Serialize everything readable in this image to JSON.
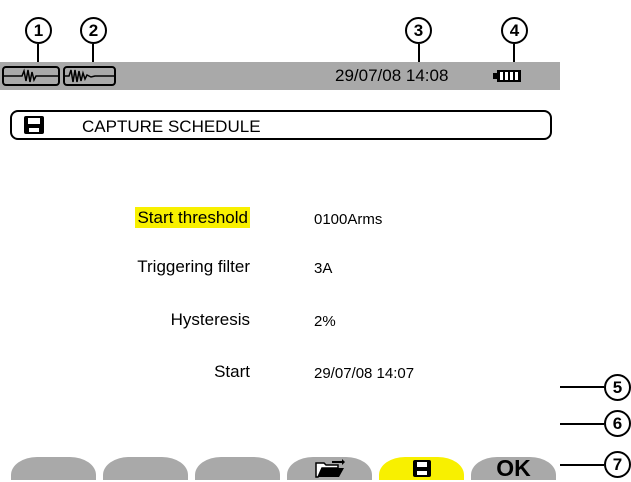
{
  "callouts": [
    "1",
    "2",
    "3",
    "4",
    "5",
    "6",
    "7"
  ],
  "status_bar": {
    "datetime": "29/07/08 14:08",
    "icons": [
      "waveform-1-icon",
      "waveform-2-icon",
      "battery-full-icon"
    ]
  },
  "header": {
    "icon": "floppy-disk-icon",
    "title": "CAPTURE SCHEDULE"
  },
  "fields": [
    {
      "label": "Start threshold",
      "value": "0100Arms",
      "selected": true
    },
    {
      "label": "Triggering filter",
      "value": "3A",
      "selected": false
    },
    {
      "label": "Hysteresis",
      "value": "2%",
      "selected": false
    },
    {
      "label": "Start",
      "value": "29/07/08 14:07",
      "selected": false
    }
  ],
  "softkeys": [
    {
      "label": "",
      "icon": ""
    },
    {
      "label": "",
      "icon": ""
    },
    {
      "label": "",
      "icon": ""
    },
    {
      "label": "",
      "icon": "folder-open-icon"
    },
    {
      "label": "",
      "icon": "floppy-disk-icon",
      "active": true
    },
    {
      "label": "OK",
      "icon": ""
    }
  ],
  "colors": {
    "status_bar": "#a9a9a9",
    "highlight": "#f8f000",
    "softkey": "#a9a9a9"
  }
}
